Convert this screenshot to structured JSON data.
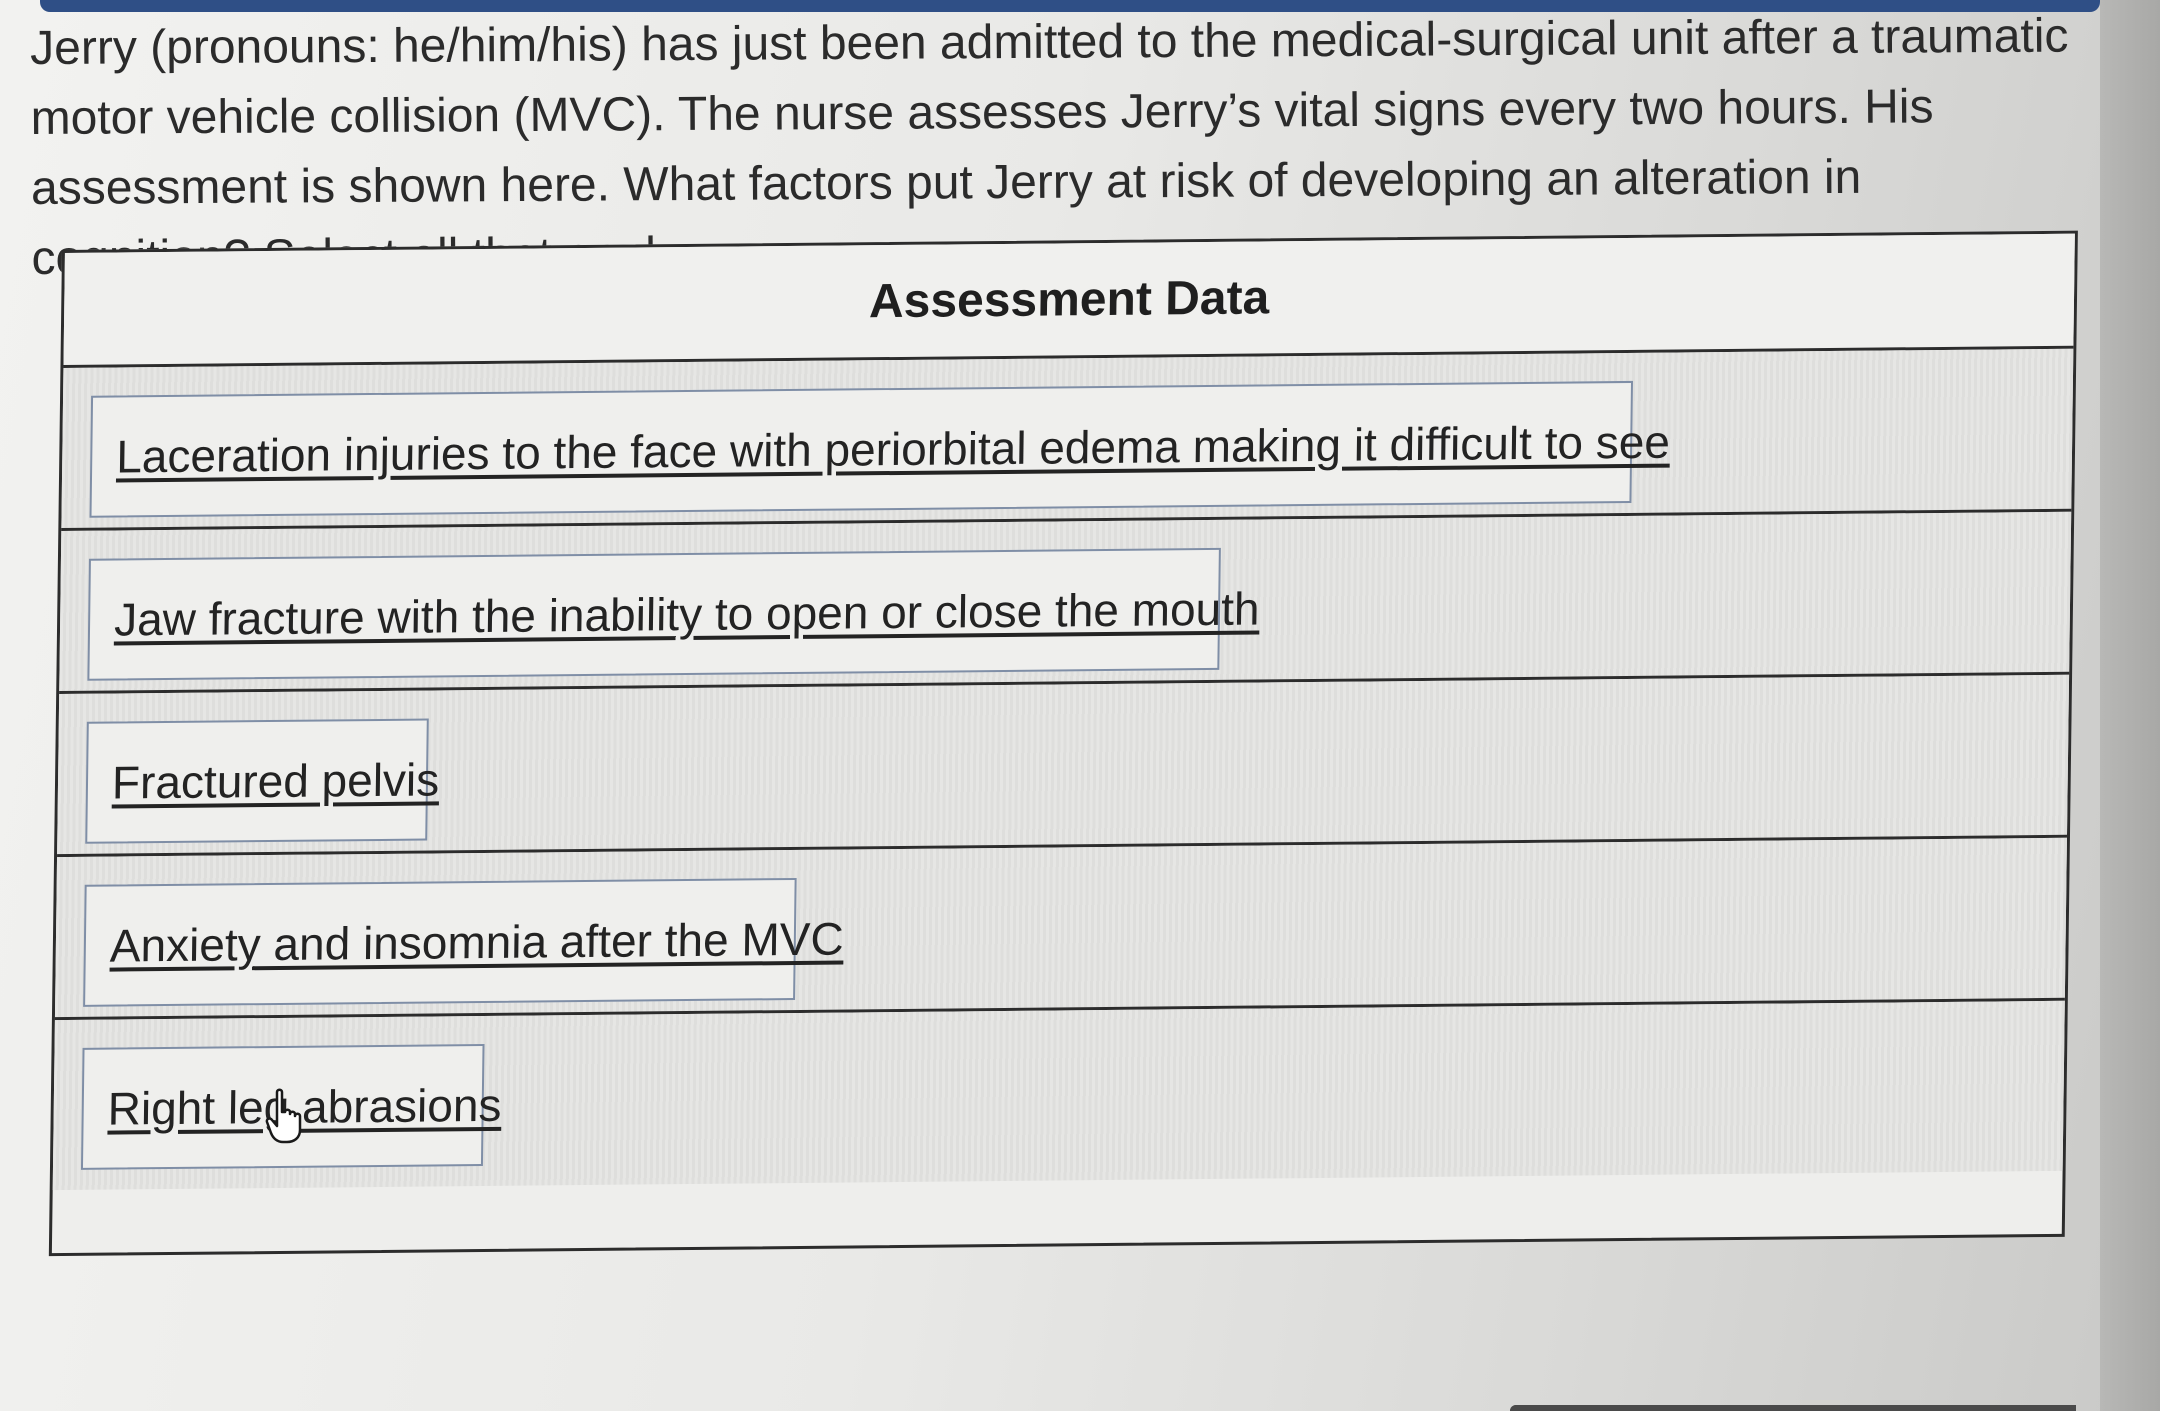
{
  "question": {
    "text": "Jerry (pronouns: he/him/his) has just been admitted to the medical-surgical unit after a traumatic motor vehicle collision (MVC). The nurse assesses Jerry’s vital signs every two hours. His assessment is shown here. What factors put Jerry at risk of developing an alteration in cognition? Select all that apply."
  },
  "table": {
    "header": "Assessment Data",
    "options": [
      "Laceration injuries to the face with periorbital edema making it difficult to see",
      "Jaw fracture with the inability to open or close the mouth",
      "Fractured pelvis",
      "Anxiety and insomnia after the MVC",
      "Right leg abrasions"
    ]
  },
  "cursor": {
    "icon": "hand-pointer-icon"
  },
  "colors": {
    "top_band": "#2f4f86",
    "option_border": "#7f8ea6"
  }
}
